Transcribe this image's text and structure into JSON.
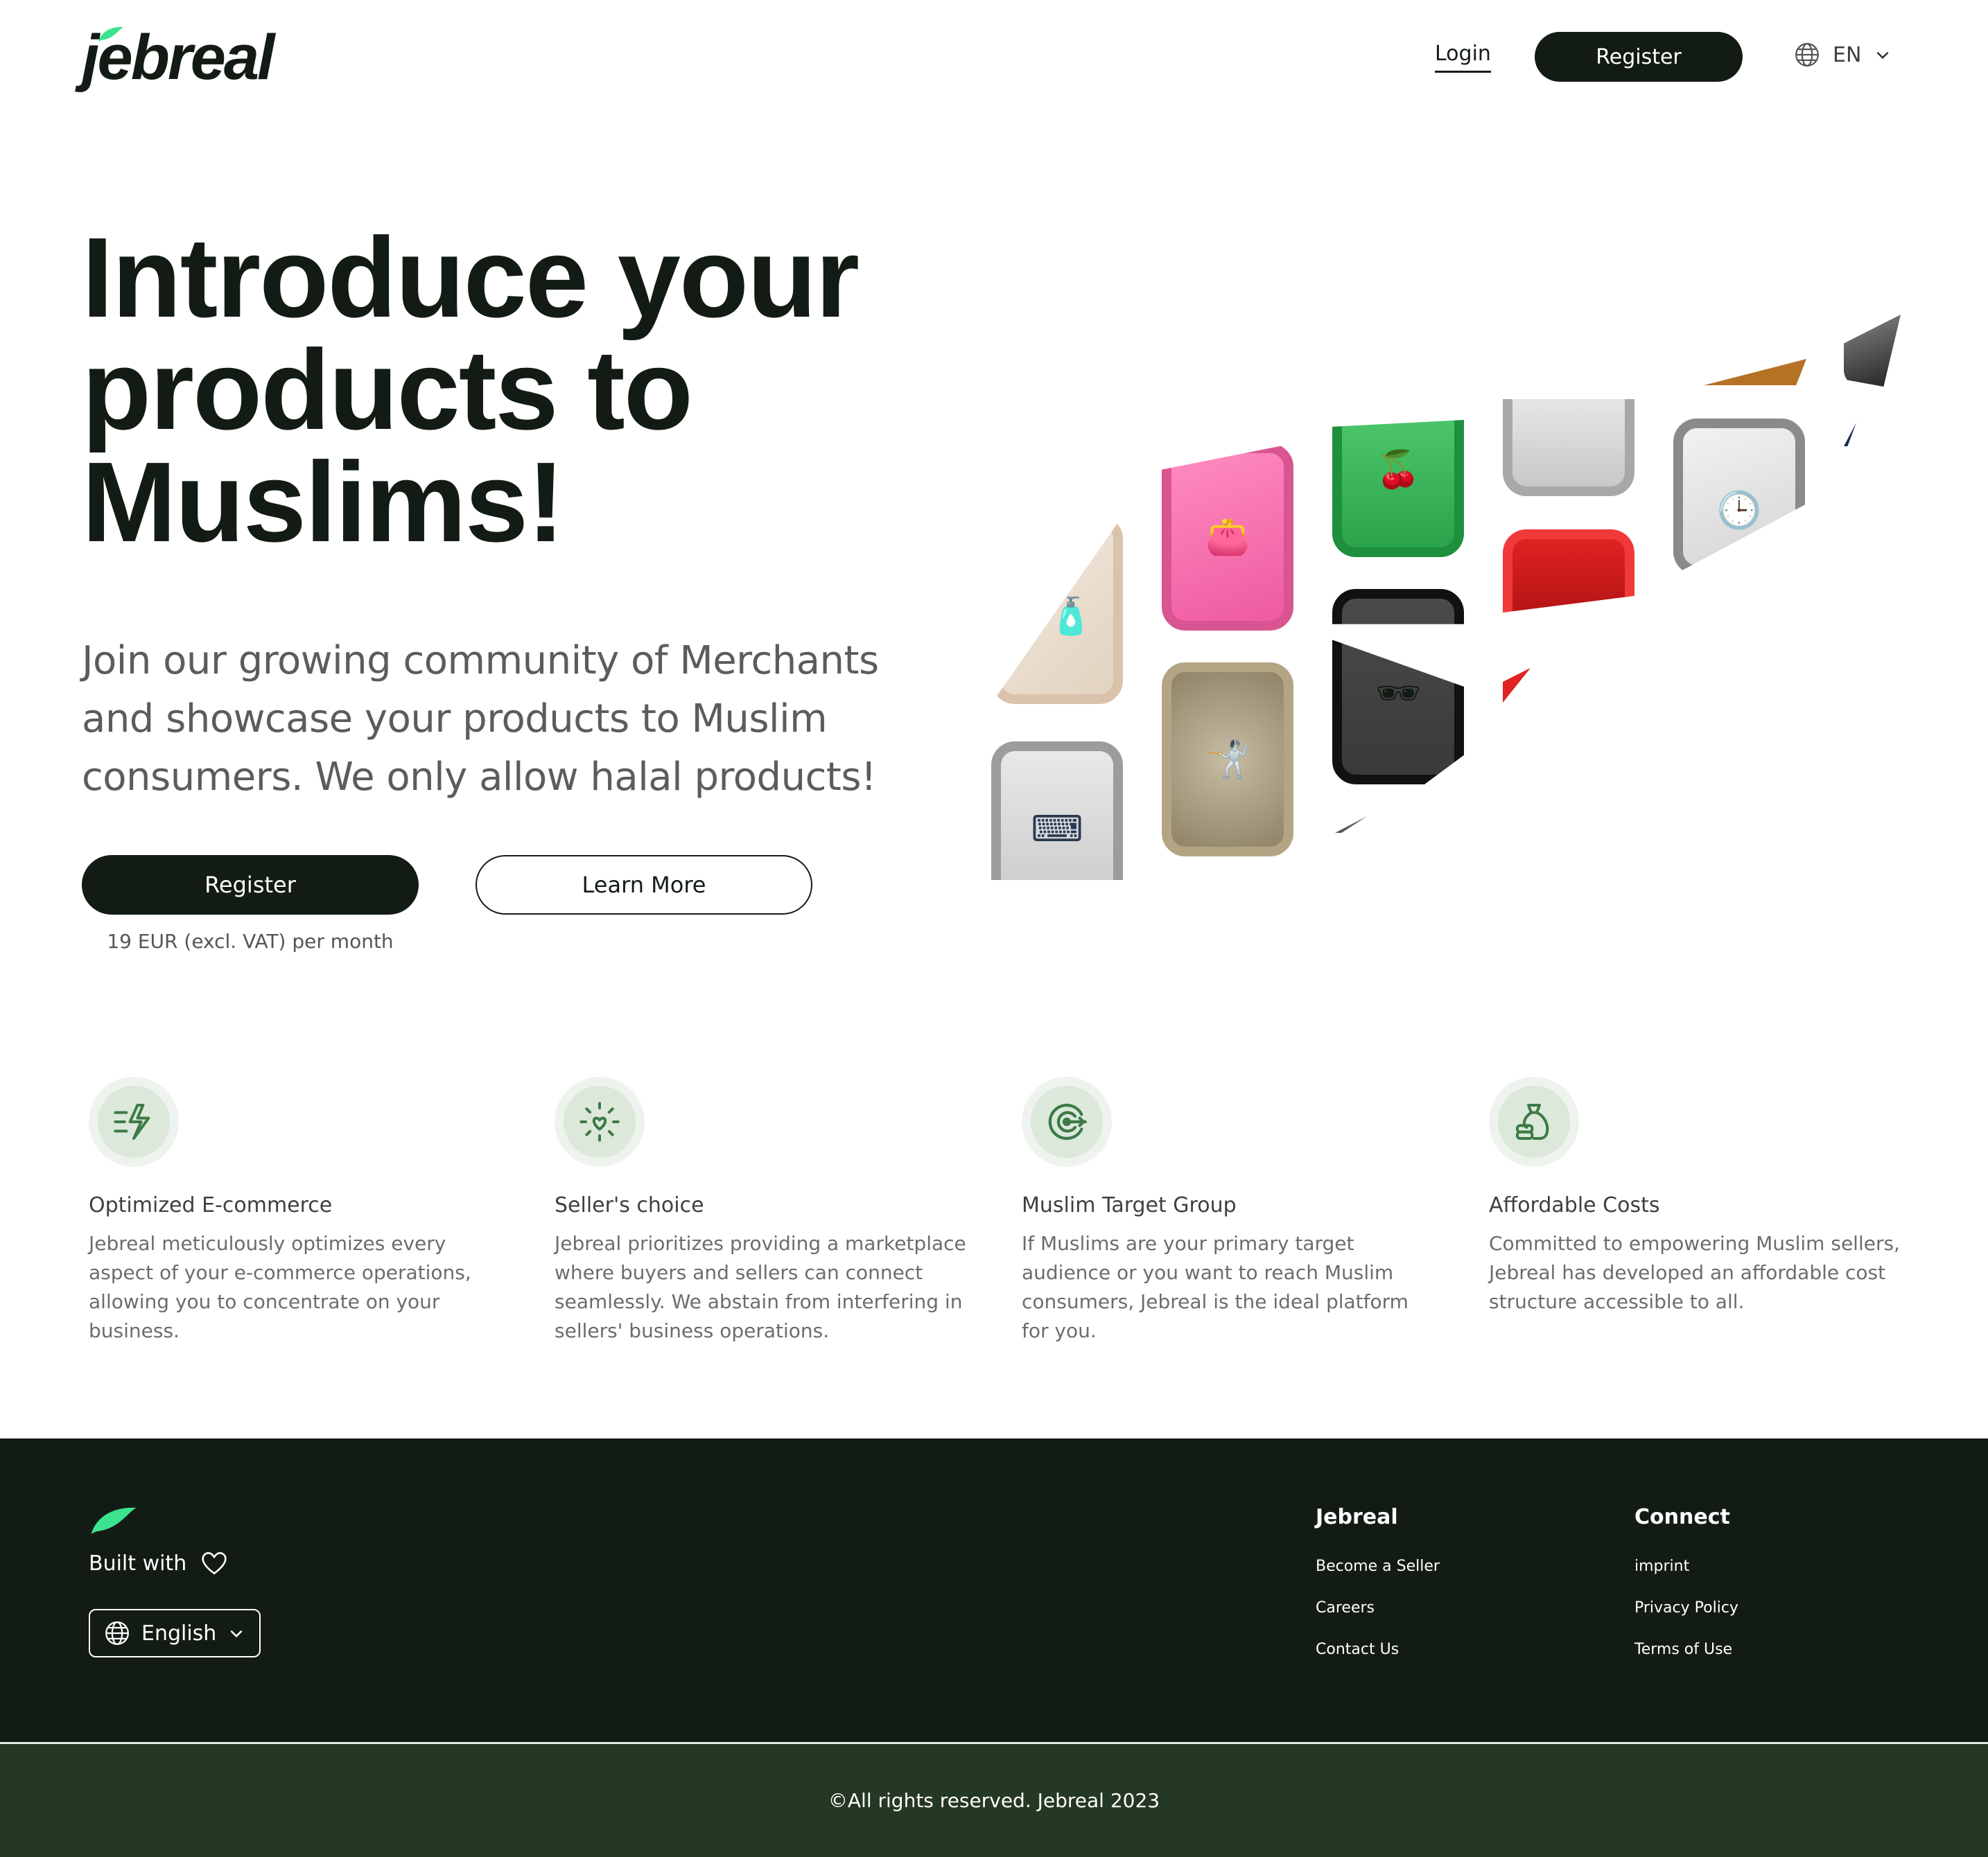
{
  "header": {
    "logo_text": "jebreal",
    "login_label": "Login",
    "register_label": "Register",
    "language_code": "EN",
    "globe_icon": "globe-icon",
    "chevron_icon": "chevron-down-icon"
  },
  "hero": {
    "title_line1": "Introduce your",
    "title_line2": "products to",
    "title_line3": "Muslims!",
    "subtitle": "Join our growing community of Merchants and showcase your products to Muslim consumers. We only allow halal products!",
    "register_label": "Register",
    "learn_more_label": "Learn More",
    "price_note": "19 EUR (excl. VAT) per month",
    "tiles": [
      {
        "name": "tile-perfume",
        "icon": "perfume-bottle-icon",
        "color": "#d9c3aa",
        "glyph": "🧴"
      },
      {
        "name": "tile-keyboard",
        "icon": "keyboard-icon",
        "color": "#9c9c9c",
        "glyph": "⌨"
      },
      {
        "name": "tile-purse",
        "icon": "purse-icon",
        "color": "#e8508e",
        "glyph": "👛"
      },
      {
        "name": "tile-fencing",
        "icon": "fencing-icon",
        "color": "#b3a584",
        "glyph": "🤺"
      },
      {
        "name": "tile-cherries",
        "icon": "cherries-icon",
        "color": "#1e8f3c",
        "glyph": "🍒"
      },
      {
        "name": "tile-sunglasses",
        "icon": "sunglasses-icon",
        "color": "#111111",
        "glyph": "🕶"
      },
      {
        "name": "tile-silver",
        "icon": "gadget-icon",
        "color": "#a8a8a8",
        "glyph": ""
      },
      {
        "name": "tile-red",
        "icon": "red-product-icon",
        "color": "#e02222",
        "glyph": ""
      },
      {
        "name": "tile-clock",
        "icon": "clock-icon",
        "color": "#8a8a8a",
        "glyph": "🕒"
      }
    ]
  },
  "features": [
    {
      "icon": "speed-bolt-icon",
      "title": "Optimized E-commerce",
      "text": "Jebreal meticulously optimizes every aspect of your e-commerce operations, allowing you to concentrate on your business."
    },
    {
      "icon": "sparkle-heart-icon",
      "title": "Seller's choice",
      "text": "Jebreal prioritizes providing a marketplace where buyers and sellers can connect seamlessly. We abstain from interfering in sellers' business operations."
    },
    {
      "icon": "target-icon",
      "title": "Muslim Target Group",
      "text": "If Muslims are your primary target audience or you want to reach Muslim consumers, Jebreal is the ideal platform for you."
    },
    {
      "icon": "money-bag-icon",
      "title": "Affordable Costs",
      "text": "Committed to empowering Muslim sellers, Jebreal has developed an affordable cost structure accessible to all."
    }
  ],
  "footer": {
    "built_with": "Built with",
    "heart_icon": "heart-icon",
    "language_label": "English",
    "col1": {
      "heading": "Jebreal",
      "links": [
        "Become a Seller",
        "Careers",
        "Contact Us"
      ]
    },
    "col2": {
      "heading": "Connect",
      "links": [
        "imprint",
        "Privacy Policy",
        "Terms of Use"
      ]
    },
    "copyright": "©All rights reserved. Jebreal 2023"
  },
  "colors": {
    "brand_dark": "#131c14",
    "brand_green": "#3ce38f",
    "footer_bottom": "#253823",
    "icon_green": "#3d7a45"
  }
}
